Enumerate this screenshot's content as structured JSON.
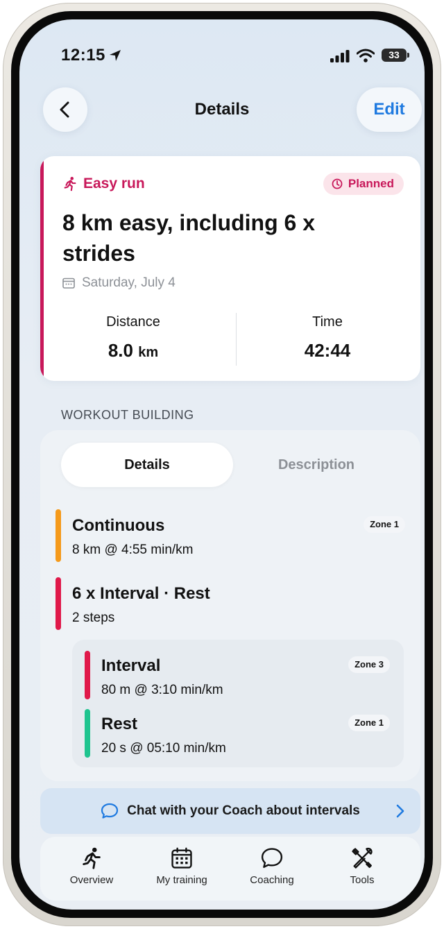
{
  "status_bar": {
    "time": "12:15",
    "battery": "33"
  },
  "header": {
    "title": "Details",
    "edit_label": "Edit"
  },
  "workout": {
    "type": "Easy run",
    "status": "Planned",
    "title": "8 km easy, including 6 x strides",
    "date": "Saturday, July 4",
    "distance_label": "Distance",
    "distance_value": "8.0",
    "distance_unit": "km",
    "time_label": "Time",
    "time_value": "42:44"
  },
  "section_label": "WORKOUT BUILDING",
  "tabs": {
    "details": "Details",
    "description": "Description"
  },
  "steps": [
    {
      "name": "Continuous",
      "detail": "8 km @ 4:55 min/km",
      "zone": "Zone 1",
      "color": "#f59a1b"
    },
    {
      "name": "6 x Interval · Rest",
      "detail": "2 steps",
      "color": "#e0194a"
    }
  ],
  "sub_steps": [
    {
      "name": "Interval",
      "detail": "80 m @ 3:10 min/km",
      "zone": "Zone 3",
      "color": "#e0194a"
    },
    {
      "name": "Rest",
      "detail": "20 s @ 05:10 min/km",
      "zone": "Zone 1",
      "color": "#1fc48f"
    }
  ],
  "chat_label": "Chat with your Coach about intervals",
  "nav": [
    {
      "label": "Overview",
      "icon": "runner-icon"
    },
    {
      "label": "My training",
      "icon": "calendar-icon"
    },
    {
      "label": "Coaching",
      "icon": "chat-bubble-icon"
    },
    {
      "label": "Tools",
      "icon": "tools-icon"
    }
  ],
  "colors": {
    "accent": "#c8185a",
    "link": "#1f7ae0"
  }
}
